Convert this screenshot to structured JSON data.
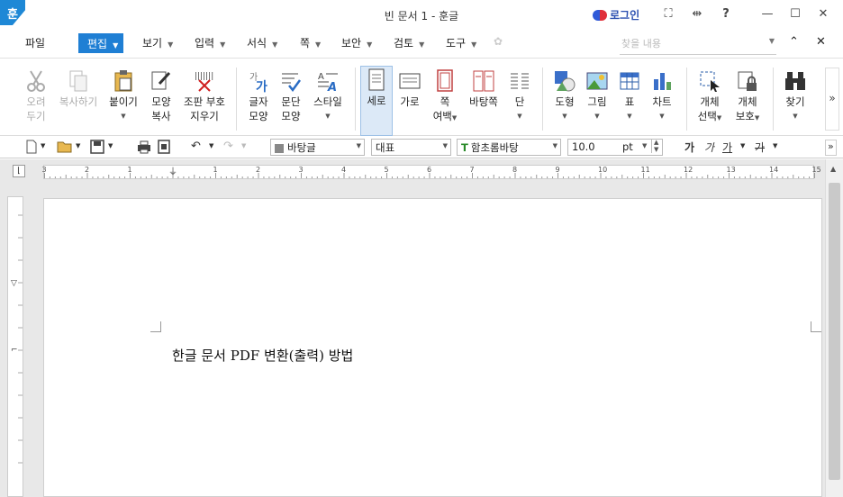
{
  "app": {
    "logo": "훈",
    "title": "빈 문서 1 - 훈글",
    "login": "로그인"
  },
  "titlebar_icons": [
    "fullscreen-icon",
    "resize-icon",
    "help-icon",
    "minimize-icon",
    "maximize-icon",
    "close-icon"
  ],
  "titlebar_glyphs": {
    "fullscreen": "⛶",
    "resize": "⇹",
    "help": "?",
    "minimize": "—",
    "maximize": "☐",
    "close": "✕"
  },
  "menu": {
    "items": [
      "파일",
      "편집",
      "보기",
      "입력",
      "서식",
      "쪽",
      "보안",
      "검토",
      "도구"
    ],
    "active": "편집"
  },
  "find": {
    "placeholder": "찾을 내용"
  },
  "menubar_glyphs": {
    "collapse": "⌃",
    "close": "✕"
  },
  "ribbon": {
    "cut": [
      "오려",
      "두기"
    ],
    "copy": [
      "복사하기"
    ],
    "paste": [
      "붙이기"
    ],
    "format_copy": [
      "모양",
      "복사"
    ],
    "clear_marks": [
      "조판 부호",
      "지우기"
    ],
    "char_shape": [
      "글자",
      "모양"
    ],
    "para_shape": [
      "문단",
      "모양"
    ],
    "style": [
      "스타일"
    ],
    "portrait": [
      "세로"
    ],
    "landscape": [
      "가로"
    ],
    "margin": [
      "쪽",
      "여백"
    ],
    "background": [
      "바탕쪽"
    ],
    "columns": [
      "단"
    ],
    "shape": [
      "도형"
    ],
    "picture": [
      "그림"
    ],
    "table": [
      "표"
    ],
    "chart": [
      "차트"
    ],
    "obj_select": [
      "개체",
      "선택"
    ],
    "obj_protect": [
      "개체",
      "보호"
    ],
    "find": [
      "찾기"
    ],
    "more": "»"
  },
  "toolbar2": {
    "style": "바탕글",
    "lang": "대표",
    "font": "함초롬바탕",
    "size": "10.0",
    "unit": "pt",
    "bold": "가",
    "italic": "가",
    "underline": "가",
    "strike": "가"
  },
  "ruler": {
    "h_numbers": [
      "3",
      "2",
      "1",
      "1",
      "2",
      "3",
      "4",
      "5",
      "6",
      "7",
      "8",
      "9",
      "10",
      "11",
      "12",
      "13",
      "14",
      "15"
    ]
  },
  "document": {
    "text": "한글 문서 PDF 변환(출력) 방법"
  }
}
